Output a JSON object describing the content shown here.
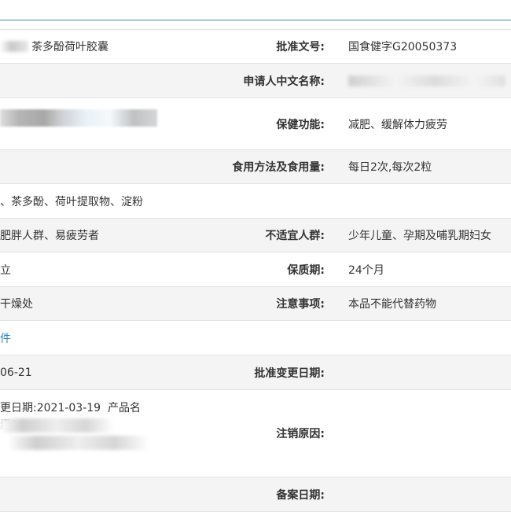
{
  "rows": {
    "r1": {
      "value": "茶多酚荷叶胶囊",
      "label": "批准文号:",
      "value2": "国食健字G20050373"
    },
    "r2": {
      "label": "申请人中文名称:"
    },
    "r3": {
      "label": "保健功能:",
      "value2": "减肥、缓解体力疲劳"
    },
    "r4": {
      "label": "食用方法及食用量:",
      "value2": "每日2次,每次2粒"
    },
    "r5": {
      "value": "、茶多酚、荷叶提取物、淀粉"
    },
    "r6": {
      "value": "肥胖人群、易疲劳者",
      "label": "不适宜人群:",
      "value2": "少年儿童、孕期及哺乳期妇女"
    },
    "r7": {
      "value": "立",
      "label": "保质期:",
      "value2": "24个月"
    },
    "r8": {
      "value": "干燥处",
      "label": "注意事项:",
      "value2": "本品不能代替药物"
    },
    "r9": {
      "link": "件"
    },
    "r10": {
      "value": "06-21",
      "label": "批准变更日期:"
    },
    "r11": {
      "line1": "更日期:2021-03-19  产品名",
      "line2": "囊\"",
      "line3": "  ",
      "label": "注销原因:"
    },
    "r12": {
      "label": "备案日期:"
    }
  }
}
